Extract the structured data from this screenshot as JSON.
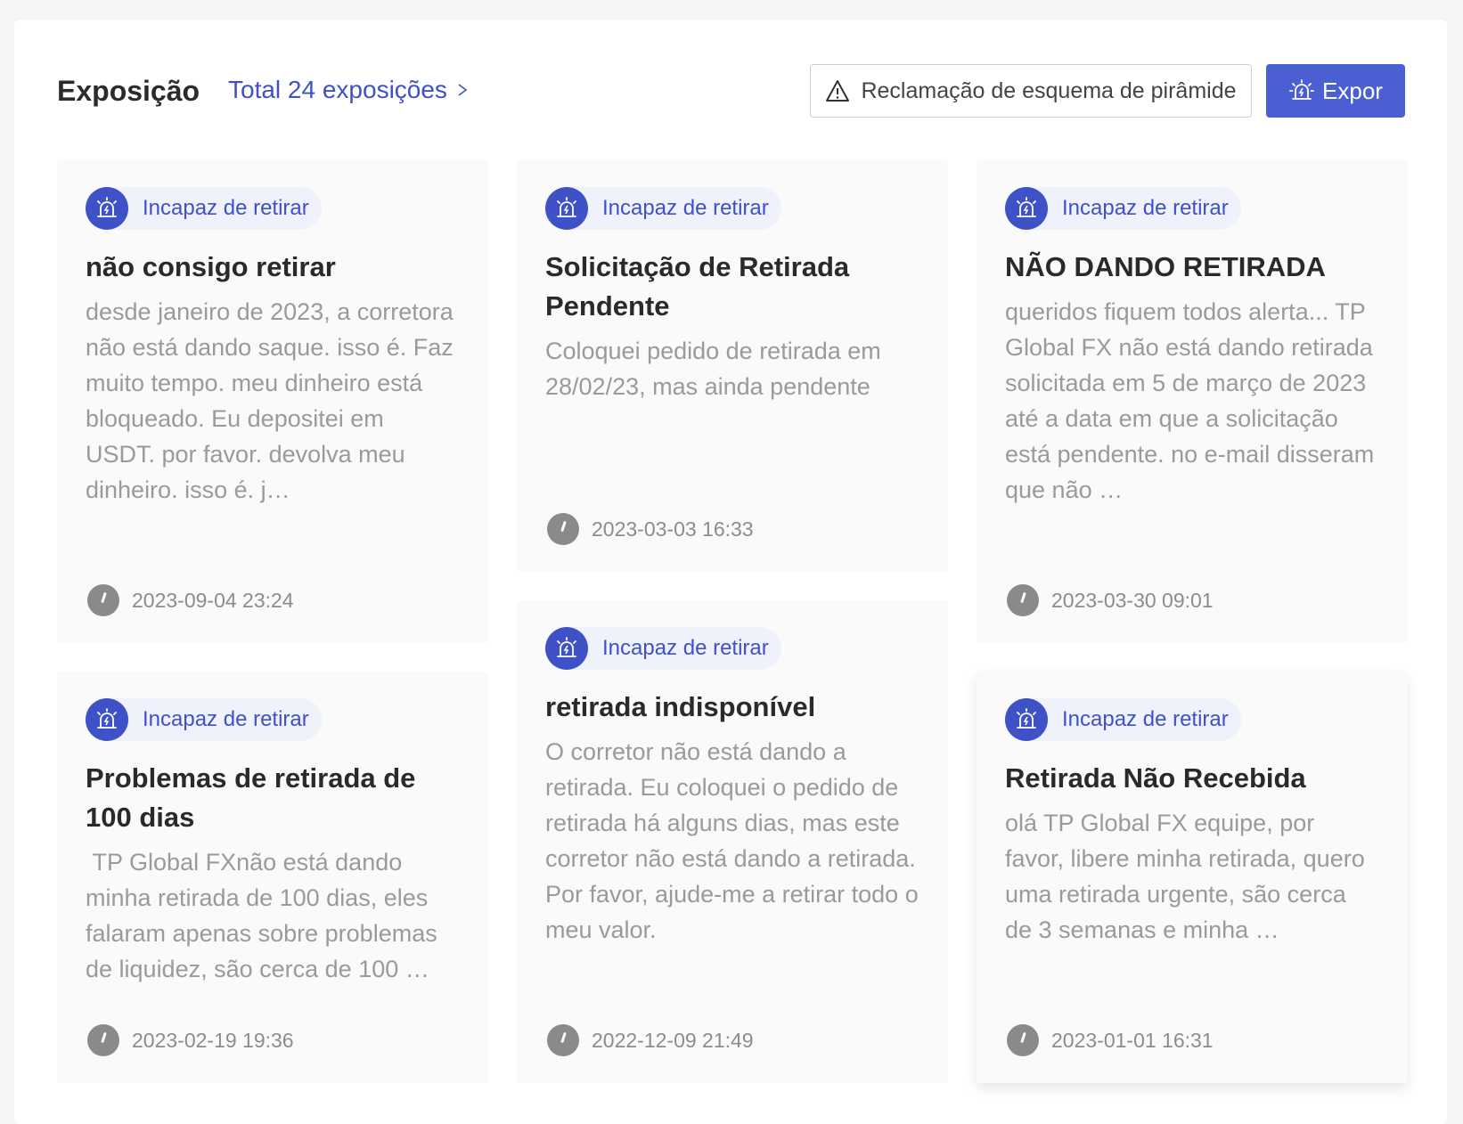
{
  "header": {
    "title": "Exposição",
    "total_link": "Total 24 exposições",
    "complaint_button": "Reclamação de esquema de pirâmide",
    "expose_button": "Expor"
  },
  "colors": {
    "accent": "#4a5fd2",
    "tag_background": "#eff1fb",
    "card_background": "#fafafa"
  },
  "cards": [
    {
      "tag": "Incapaz de retirar",
      "title": "não consigo retirar",
      "body": "desde janeiro de 2023, a corretora não está dando saque. isso é. Faz muito tempo. meu dinheiro está bloqueado. Eu depositei em USDT. por favor. devolva meu dinheiro. isso é. j…",
      "date": "2023-09-04 23:24"
    },
    {
      "tag": "Incapaz de retirar",
      "title": "Solicitação de Retirada Pendente",
      "body": "Coloquei pedido de retirada em 28/02/23, mas ainda pendente",
      "date": "2023-03-03 16:33"
    },
    {
      "tag": "Incapaz de retirar",
      "title": "NÃO DANDO RETIRADA",
      "body": "queridos fiquem todos alerta... TP Global FX não está dando retirada solicitada em 5 de março de 2023 até a data em que a solicitação está pendente. no e-mail disseram que não …",
      "date": "2023-03-30 09:01"
    },
    {
      "tag": "Incapaz de retirar",
      "title": "Problemas de retirada de 100 dias",
      "body": " TP Global FXnão está dando minha retirada de 100 dias, eles falaram apenas sobre problemas de liquidez, são cerca de 100 …",
      "date": "2023-02-19 19:36"
    },
    {
      "tag": "Incapaz de retirar",
      "title": "retirada indisponível",
      "body": "O corretor não está dando a retirada. Eu coloquei o pedido de retirada há alguns dias, mas este corretor não está dando a retirada. Por favor, ajude-me a retirar todo o meu valor.",
      "date": "2022-12-09 21:49"
    },
    {
      "tag": "Incapaz de retirar",
      "title": "Retirada Não Recebida",
      "body": "olá TP Global FX equipe, por favor, libere minha retirada, quero uma retirada urgente, são cerca de 3 semanas e minha …",
      "date": "2023-01-01 16:31"
    }
  ]
}
